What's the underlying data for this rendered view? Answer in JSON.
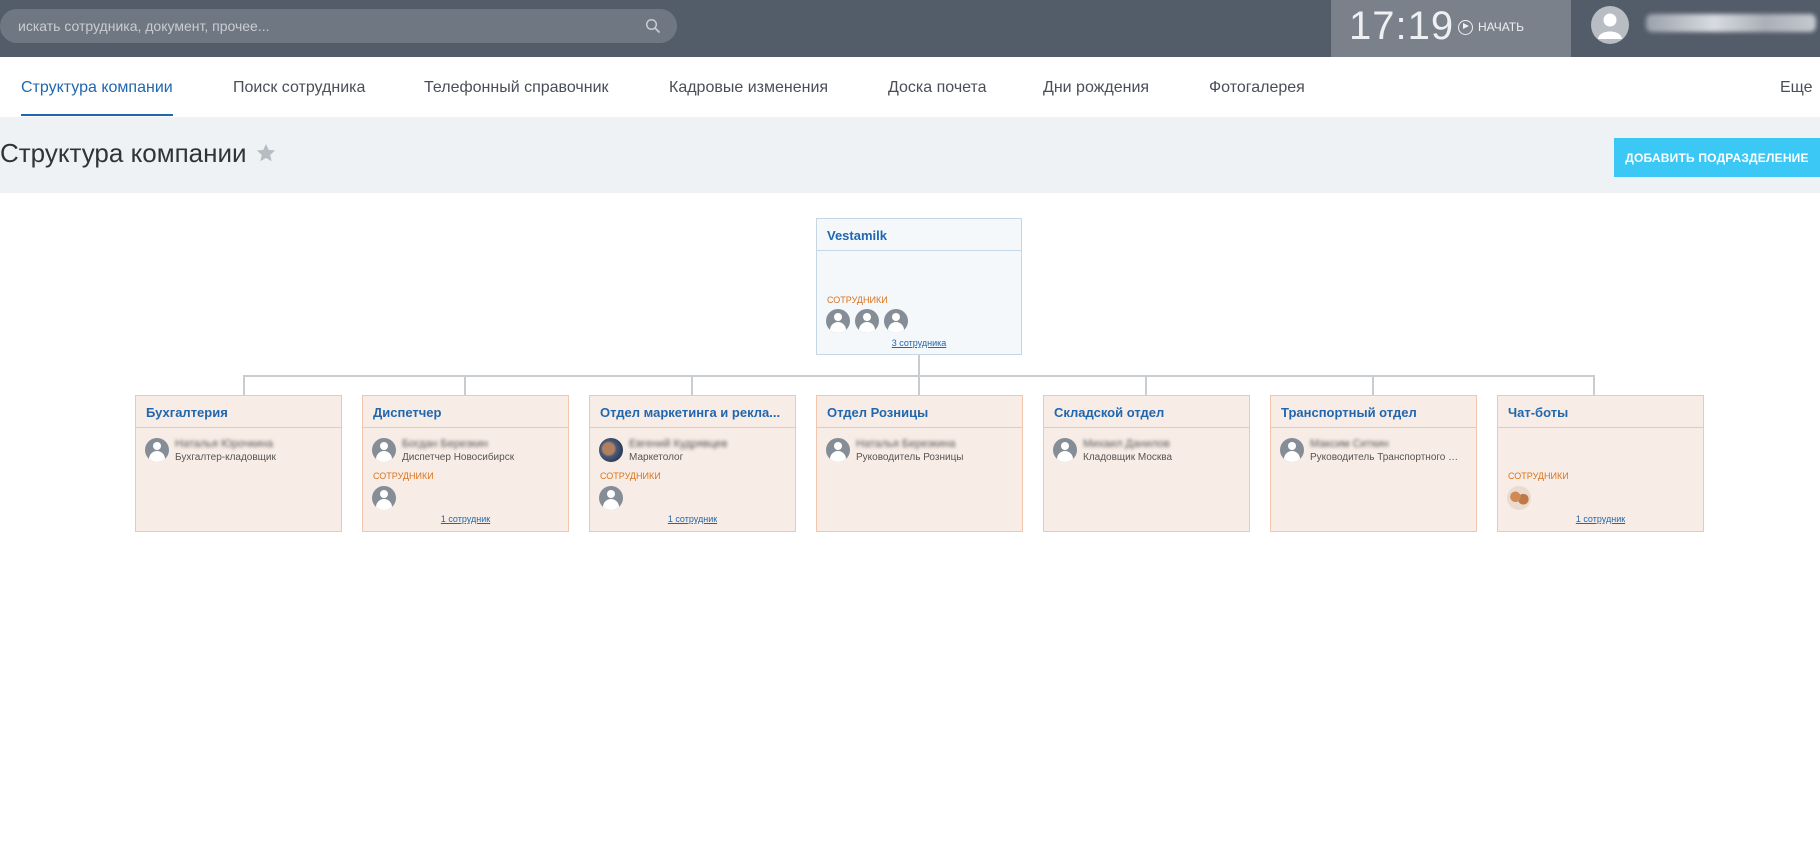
{
  "header": {
    "search_placeholder": "искать сотрудника, документ, прочее...",
    "clock": "17:19",
    "start_label": "НАЧАТЬ"
  },
  "tabs": [
    {
      "label": "Структура компании",
      "active": true
    },
    {
      "label": "Поиск сотрудника"
    },
    {
      "label": "Телефонный справочник"
    },
    {
      "label": "Кадровые изменения"
    },
    {
      "label": "Доска почета"
    },
    {
      "label": "Дни рождения"
    },
    {
      "label": "Фотогалерея"
    },
    {
      "label": "Еще"
    }
  ],
  "page": {
    "title": "Структура компании",
    "add_button": "ДОБАВИТЬ ПОДРАЗДЕЛЕНИЕ"
  },
  "root": {
    "name": "Vestamilk",
    "employees_label": "СОТРУДНИКИ",
    "employees_link": "3 сотрудника"
  },
  "departments": [
    {
      "name": "Бухгалтерия",
      "head_name": "Наталья Юрочкина",
      "head_position": "Бухгалтер-кладовщик"
    },
    {
      "name": "Диспетчер",
      "head_name": "Богдан Березкин",
      "head_position": "Диспетчер Новосибирск",
      "employees_label": "СОТРУДНИКИ",
      "employees_link": "1 сотрудник"
    },
    {
      "name": "Отдел маркетинга и рекла...",
      "head_name": "Евгений Кудрявцев",
      "head_position": "Маркетолог",
      "employees_label": "СОТРУДНИКИ",
      "employees_link": "1 сотрудник"
    },
    {
      "name": "Отдел Розницы",
      "head_name": "Наталья Березкина",
      "head_position": "Руководитель Розницы"
    },
    {
      "name": "Складской отдел",
      "head_name": "Михаил Данилов",
      "head_position": "Кладовщик Москва"
    },
    {
      "name": "Транспортный отдел",
      "head_name": "Максим Ситкин",
      "head_position": "Руководитель Транспортного о..."
    },
    {
      "name": "Чат-боты",
      "employees_label": "СОТРУДНИКИ",
      "employees_link": "1 сотрудник"
    }
  ],
  "icons": [
    "search-icon",
    "play-icon",
    "user-avatar-icon",
    "star-icon",
    "employee-icon"
  ],
  "colors": {
    "topbar": "#535c69",
    "accent": "#2067b0",
    "add_button": "#3bc8f5",
    "dept_bg": "#f8ede6",
    "dept_border": "#f2c6ad",
    "employees_label": "#d9731c"
  }
}
